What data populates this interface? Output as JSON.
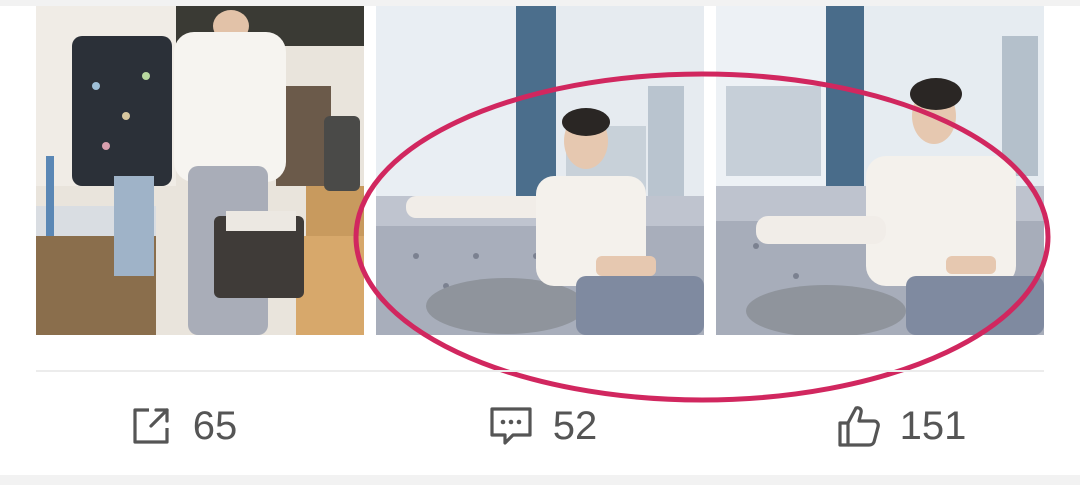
{
  "post": {
    "photos": [
      {
        "alt": ""
      },
      {
        "alt": ""
      },
      {
        "alt": ""
      }
    ]
  },
  "actions": {
    "share": {
      "icon": "share-icon",
      "count": "65"
    },
    "comment": {
      "icon": "comment-icon",
      "count": "52"
    },
    "like": {
      "icon": "thumbs-up-icon",
      "count": "151"
    }
  },
  "colors": {
    "annotation_circle": "#d1275f",
    "action_text": "#555555",
    "divider": "#ececec"
  }
}
